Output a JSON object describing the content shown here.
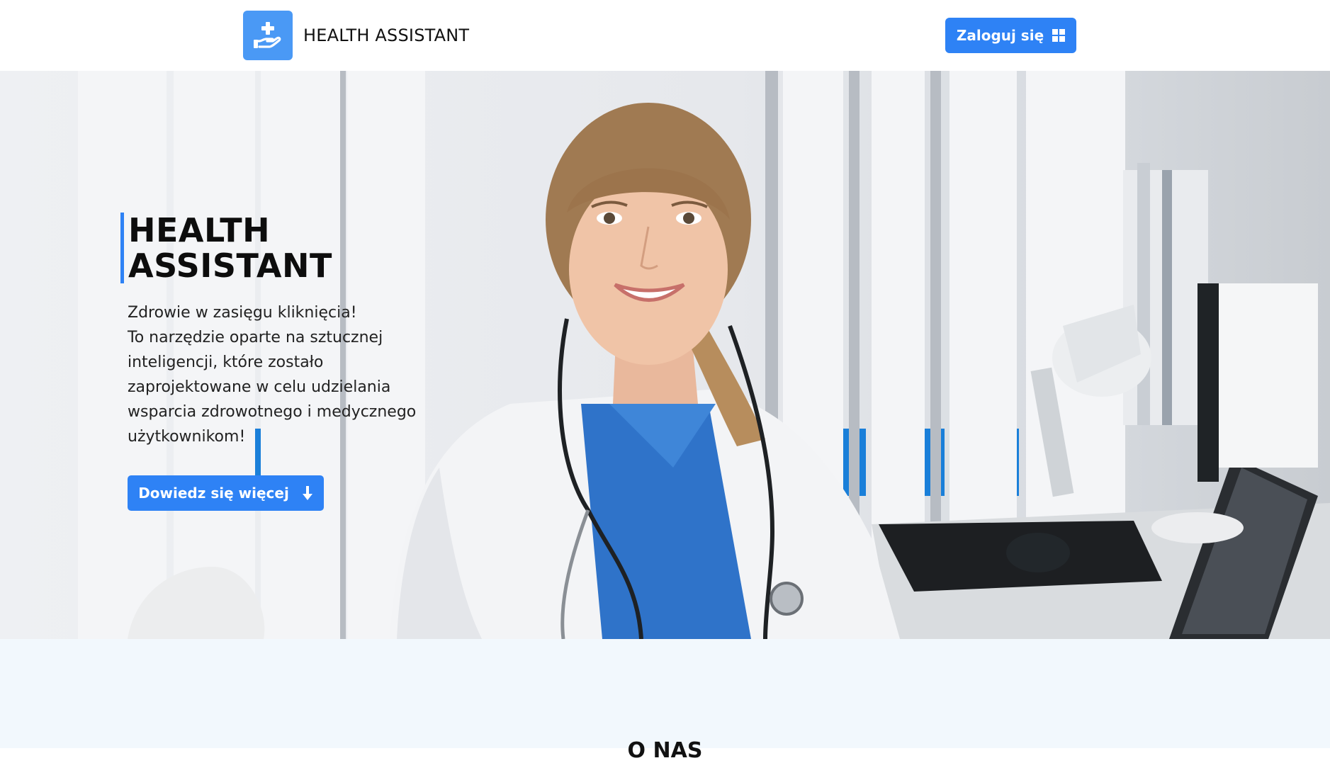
{
  "header": {
    "logo_text": "HEALTH ASSISTANT",
    "logo_icon": "hand-plus-icon",
    "login_label": "Zaloguj się",
    "login_icon": "windows-icon"
  },
  "hero": {
    "title_line1": "HEALTH",
    "title_line2": "ASSISTANT",
    "desc_lines": [
      "Zdrowie w zasięgu kliknięcia!",
      "To narzędzie oparte na sztucznej",
      "inteligencji, które zostało",
      "zaprojektowane w celu udzielania",
      "wsparcia zdrowotnego i medycznego",
      "użytkownikom!"
    ],
    "cta_label": "Dowiedz się więcej",
    "cta_icon": "arrow-down-icon",
    "photo": "doctor-photo"
  },
  "about": {
    "title": "O NAS"
  },
  "colors": {
    "accent": "#2e82f5",
    "logo_bg": "#4a99f5",
    "section_bg": "#f2f8fd"
  }
}
